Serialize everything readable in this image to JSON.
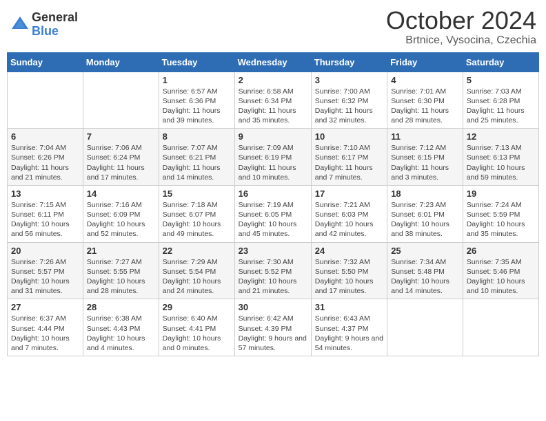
{
  "header": {
    "logo_general": "General",
    "logo_blue": "Blue",
    "month_title": "October 2024",
    "location": "Brtnice, Vysocina, Czechia"
  },
  "weekdays": [
    "Sunday",
    "Monday",
    "Tuesday",
    "Wednesday",
    "Thursday",
    "Friday",
    "Saturday"
  ],
  "weeks": [
    [
      {
        "day": "",
        "info": ""
      },
      {
        "day": "",
        "info": ""
      },
      {
        "day": "1",
        "info": "Sunrise: 6:57 AM\nSunset: 6:36 PM\nDaylight: 11 hours and 39 minutes."
      },
      {
        "day": "2",
        "info": "Sunrise: 6:58 AM\nSunset: 6:34 PM\nDaylight: 11 hours and 35 minutes."
      },
      {
        "day": "3",
        "info": "Sunrise: 7:00 AM\nSunset: 6:32 PM\nDaylight: 11 hours and 32 minutes."
      },
      {
        "day": "4",
        "info": "Sunrise: 7:01 AM\nSunset: 6:30 PM\nDaylight: 11 hours and 28 minutes."
      },
      {
        "day": "5",
        "info": "Sunrise: 7:03 AM\nSunset: 6:28 PM\nDaylight: 11 hours and 25 minutes."
      }
    ],
    [
      {
        "day": "6",
        "info": "Sunrise: 7:04 AM\nSunset: 6:26 PM\nDaylight: 11 hours and 21 minutes."
      },
      {
        "day": "7",
        "info": "Sunrise: 7:06 AM\nSunset: 6:24 PM\nDaylight: 11 hours and 17 minutes."
      },
      {
        "day": "8",
        "info": "Sunrise: 7:07 AM\nSunset: 6:21 PM\nDaylight: 11 hours and 14 minutes."
      },
      {
        "day": "9",
        "info": "Sunrise: 7:09 AM\nSunset: 6:19 PM\nDaylight: 11 hours and 10 minutes."
      },
      {
        "day": "10",
        "info": "Sunrise: 7:10 AM\nSunset: 6:17 PM\nDaylight: 11 hours and 7 minutes."
      },
      {
        "day": "11",
        "info": "Sunrise: 7:12 AM\nSunset: 6:15 PM\nDaylight: 11 hours and 3 minutes."
      },
      {
        "day": "12",
        "info": "Sunrise: 7:13 AM\nSunset: 6:13 PM\nDaylight: 10 hours and 59 minutes."
      }
    ],
    [
      {
        "day": "13",
        "info": "Sunrise: 7:15 AM\nSunset: 6:11 PM\nDaylight: 10 hours and 56 minutes."
      },
      {
        "day": "14",
        "info": "Sunrise: 7:16 AM\nSunset: 6:09 PM\nDaylight: 10 hours and 52 minutes."
      },
      {
        "day": "15",
        "info": "Sunrise: 7:18 AM\nSunset: 6:07 PM\nDaylight: 10 hours and 49 minutes."
      },
      {
        "day": "16",
        "info": "Sunrise: 7:19 AM\nSunset: 6:05 PM\nDaylight: 10 hours and 45 minutes."
      },
      {
        "day": "17",
        "info": "Sunrise: 7:21 AM\nSunset: 6:03 PM\nDaylight: 10 hours and 42 minutes."
      },
      {
        "day": "18",
        "info": "Sunrise: 7:23 AM\nSunset: 6:01 PM\nDaylight: 10 hours and 38 minutes."
      },
      {
        "day": "19",
        "info": "Sunrise: 7:24 AM\nSunset: 5:59 PM\nDaylight: 10 hours and 35 minutes."
      }
    ],
    [
      {
        "day": "20",
        "info": "Sunrise: 7:26 AM\nSunset: 5:57 PM\nDaylight: 10 hours and 31 minutes."
      },
      {
        "day": "21",
        "info": "Sunrise: 7:27 AM\nSunset: 5:55 PM\nDaylight: 10 hours and 28 minutes."
      },
      {
        "day": "22",
        "info": "Sunrise: 7:29 AM\nSunset: 5:54 PM\nDaylight: 10 hours and 24 minutes."
      },
      {
        "day": "23",
        "info": "Sunrise: 7:30 AM\nSunset: 5:52 PM\nDaylight: 10 hours and 21 minutes."
      },
      {
        "day": "24",
        "info": "Sunrise: 7:32 AM\nSunset: 5:50 PM\nDaylight: 10 hours and 17 minutes."
      },
      {
        "day": "25",
        "info": "Sunrise: 7:34 AM\nSunset: 5:48 PM\nDaylight: 10 hours and 14 minutes."
      },
      {
        "day": "26",
        "info": "Sunrise: 7:35 AM\nSunset: 5:46 PM\nDaylight: 10 hours and 10 minutes."
      }
    ],
    [
      {
        "day": "27",
        "info": "Sunrise: 6:37 AM\nSunset: 4:44 PM\nDaylight: 10 hours and 7 minutes."
      },
      {
        "day": "28",
        "info": "Sunrise: 6:38 AM\nSunset: 4:43 PM\nDaylight: 10 hours and 4 minutes."
      },
      {
        "day": "29",
        "info": "Sunrise: 6:40 AM\nSunset: 4:41 PM\nDaylight: 10 hours and 0 minutes."
      },
      {
        "day": "30",
        "info": "Sunrise: 6:42 AM\nSunset: 4:39 PM\nDaylight: 9 hours and 57 minutes."
      },
      {
        "day": "31",
        "info": "Sunrise: 6:43 AM\nSunset: 4:37 PM\nDaylight: 9 hours and 54 minutes."
      },
      {
        "day": "",
        "info": ""
      },
      {
        "day": "",
        "info": ""
      }
    ]
  ]
}
